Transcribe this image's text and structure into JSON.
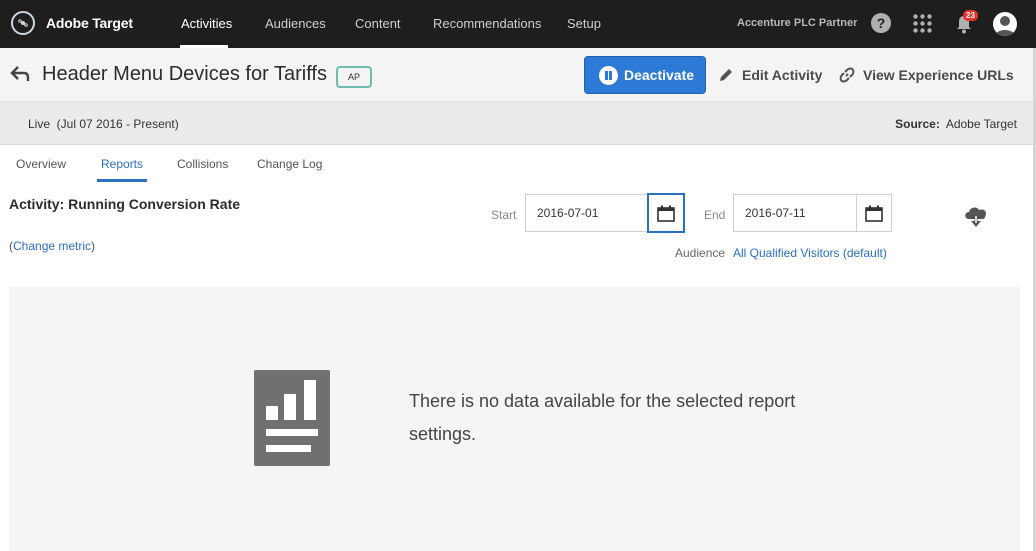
{
  "topnav": {
    "brand": "Adobe Target",
    "items": [
      "Activities",
      "Audiences",
      "Content",
      "Recommendations",
      "Setup"
    ],
    "active": "Activities",
    "partner": "Accenture PLC Partner",
    "help": "?",
    "notification_count": "23"
  },
  "header": {
    "title": "Header Menu Devices for Tariffs",
    "badge": "AP",
    "deactivate_label": "Deactivate",
    "edit_label": "Edit Activity",
    "urls_label": "View Experience URLs"
  },
  "status": {
    "text": "Live  (Jul 07 2016 - Present)",
    "source_label": "Source:",
    "source_value": "Adobe Target"
  },
  "tabs": [
    "Overview",
    "Reports",
    "Collisions",
    "Change Log"
  ],
  "report": {
    "metric_title": "Activity: Running Conversion Rate",
    "change_open": "(",
    "change_metric": "Change metric",
    "change_close": ")",
    "start_label": "Start",
    "start_value": "2016-07-01",
    "end_label": "End",
    "end_value": "2016-07-11",
    "audience_label": "Audience",
    "audience_value": "All Qualified Visitors (default)",
    "empty_message": "There is no data available for the selected report settings."
  },
  "colors": {
    "accent": "#2d7ad6",
    "topbar": "#1e1e1e",
    "badge": "#e4322b",
    "ap_border": "#6ebfb0"
  },
  "icons": [
    "adobe-target-logo-icon",
    "help-icon",
    "apps-grid-icon",
    "bell-icon",
    "user-avatar-icon",
    "back-arrow-icon",
    "pause-icon",
    "pencil-icon",
    "link-icon",
    "calendar-icon",
    "cloud-download-icon",
    "bar-chart-report-icon"
  ]
}
